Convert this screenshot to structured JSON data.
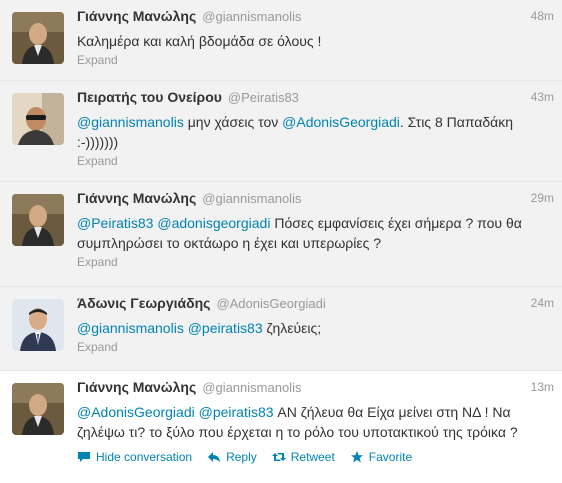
{
  "tweets": [
    {
      "name": "Γιάννης Μανώλης",
      "handle": "@giannismanolis",
      "time": "48m",
      "text": "Καλημέρα και καλή βδομάδα σε όλους !",
      "expand": "Expand"
    },
    {
      "name": "Πειρατής του Ονείρου",
      "handle": "@Peiratis83",
      "time": "43m",
      "m1": "@giannismanolis",
      "t1": " μην χάσεις τον ",
      "m2": "@AdonisGeorgiadi",
      "t2": ". Στις 8 Παπαδάκη :-)))))))",
      "expand": "Expand"
    },
    {
      "name": "Γιάννης Μανώλης",
      "handle": "@giannismanolis",
      "time": "29m",
      "m1": "@Peiratis83",
      "m2": "@adonisgeorgiadi",
      "t1": " Πόσες εμφανίσεις έχει σήμερα ? που θα συμπληρώσει το οκτάωρο η έχει και υπερωρίες ?",
      "expand": "Expand"
    },
    {
      "name": "Άδωνις Γεωργιάδης",
      "handle": "@AdonisGeorgiadi",
      "time": "24m",
      "m1": "@giannismanolis",
      "m2": "@peiratis83",
      "t1": " ζηλεύεις;",
      "expand": "Expand"
    },
    {
      "name": "Γιάννης Μανώλης",
      "handle": "@giannismanolis",
      "time": "13m",
      "m1": "@AdonisGeorgiadi",
      "m2": "@peiratis83",
      "t1": " ΑΝ ζήλευα θα Είχα μείνει στη ΝΔ ! Να ζηλέψω τι? το ξύλο που έρχεται η το ρόλο του υποτακτικού της τρόικα ?",
      "actions": {
        "hide": "Hide conversation",
        "reply": "Reply",
        "retweet": "Retweet",
        "favorite": "Favorite"
      }
    }
  ],
  "colors": {
    "link": "#0084b4",
    "muted": "#999999",
    "favorite": "#0084b4"
  }
}
